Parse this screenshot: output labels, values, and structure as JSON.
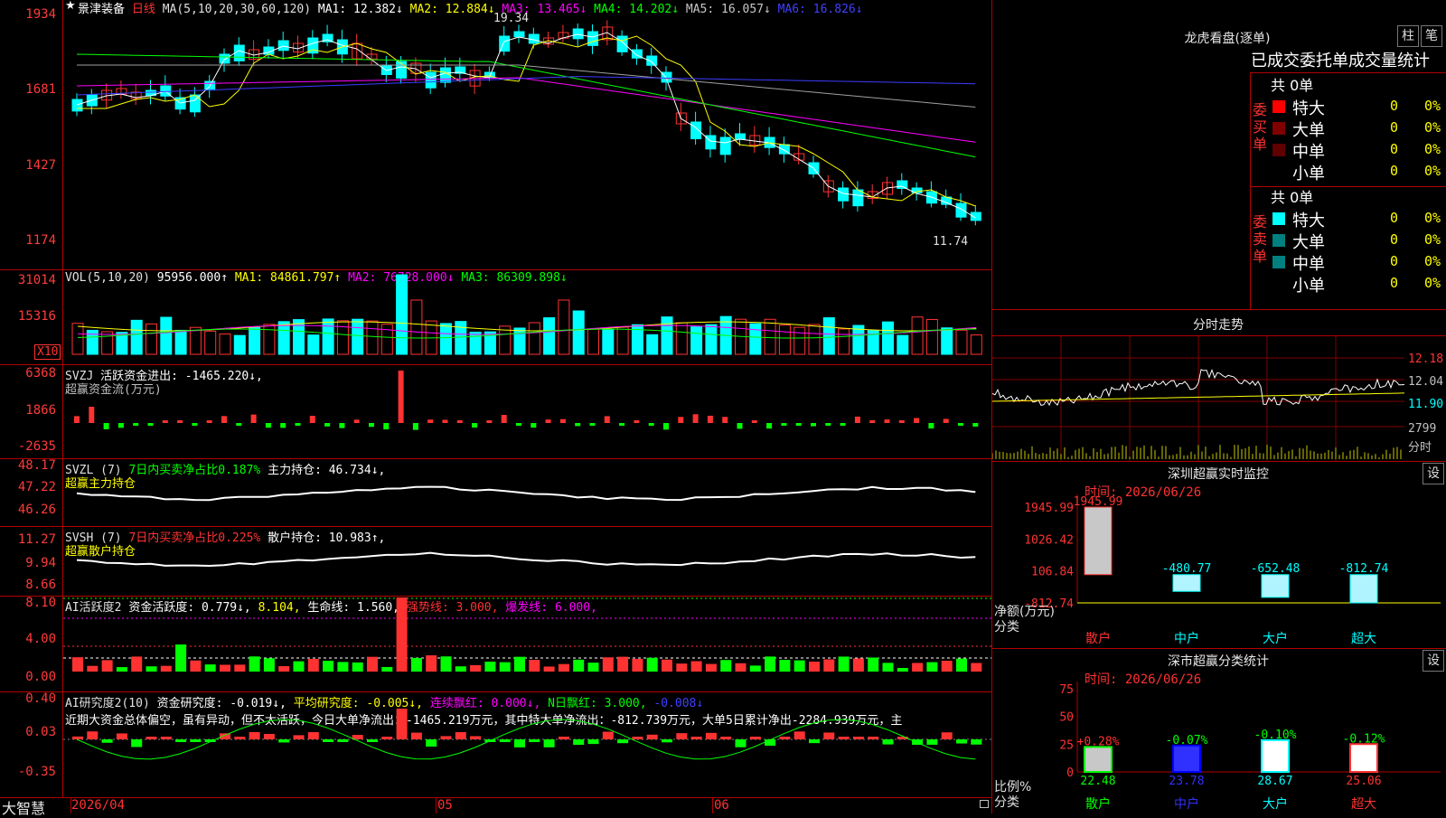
{
  "app": {
    "name": "大智慧"
  },
  "stock": {
    "name": "景津装备",
    "period": "日线"
  },
  "colors": {
    "up": "#ff3232",
    "down": "#00ffff",
    "ma1": "#ffffff",
    "ma2": "#ffff00",
    "ma3": "#ff00ff",
    "ma4": "#00ff00",
    "ma5": "#a0a0a0",
    "ma6": "#3c3cff",
    "vol_ma1": "#ffff00",
    "vol_ma2": "#ff00ff",
    "vol_ma3": "#00ff00",
    "hot": "#ff00ff",
    "green": "#00ff00"
  },
  "price_panel": {
    "header": {
      "ma_params": "MA(5,10,20,30,60,120)",
      "ma1": "MA1: 12.382↓",
      "ma2": "MA2: 12.884↓",
      "ma3": "MA3: 13.465↓",
      "ma4": "MA4: 14.202↓",
      "ma5": "MA5: 16.057↓",
      "ma6": "MA6: 16.826↓"
    },
    "y_ticks": [
      "1934",
      "1681",
      "1427",
      "1174"
    ],
    "high_label": "19.34",
    "low_label": "11.74"
  },
  "volume_panel": {
    "header": {
      "label": "VOL(5,10,20)",
      "value": "95956.000↑",
      "ma1": "MA1: 84861.797↑",
      "ma2": "MA2: 76728.000↓",
      "ma3": "MA3: 86309.898↓"
    },
    "y_ticks": [
      "31014",
      "15316"
    ],
    "unit": "X10"
  },
  "svzj_panel": {
    "header": {
      "label": "SVZJ",
      "text": "活跃资金进出: -1465.220↓,",
      "sub": "超赢资金流(万元)"
    },
    "y_ticks": [
      "6368",
      "1866",
      "-2635"
    ]
  },
  "svzl_panel": {
    "header": {
      "label": "SVZL (7)",
      "text1": "7日内买卖净占比0.187%",
      "text2": "主力持仓: 46.734↓,",
      "sub": "超赢主力持仓"
    },
    "y_ticks": [
      "48.17",
      "47.22",
      "46.26"
    ]
  },
  "svsh_panel": {
    "header": {
      "label": "SVSH (7)",
      "text1": "7日内买卖净占比0.225%",
      "text2": "散户持仓: 10.983↑,",
      "sub": "超赢散户持仓"
    },
    "y_ticks": [
      "11.27",
      "9.94",
      "8.66"
    ]
  },
  "ai_active_panel": {
    "header": {
      "label": "AI活跃度2",
      "t1": "资金活跃度: 0.779↓,",
      "t2": "8.104,",
      "t3": "生命线: 1.560,",
      "t4": "强势线: 3.000,",
      "t5": "爆发线: 6.000,"
    },
    "y_ticks": [
      "8.10",
      "4.00",
      "0.00"
    ]
  },
  "ai_research_panel": {
    "header": {
      "label": "AI研究度2(10)",
      "t1": "资金研究度: -0.019↓,",
      "t2": "平均研究度: -0.005↓,",
      "t3": "连续飘红: 0.000↓,",
      "t4": "N日飘红: 3.000,",
      "t5": "-0.008↓"
    },
    "text": "近期大资金总体偏空，虽有异动，但不太活跃，今日大单净流出：-1465.219万元，其中特大单净流出：-812.739万元，大单5日累计净出-2284.939万元，主",
    "y_ticks": [
      "0.40",
      "0.03",
      "-0.35"
    ]
  },
  "x_axis": {
    "labels": [
      "2026/04",
      "05",
      "06"
    ]
  },
  "right": {
    "dragon": {
      "title": "龙虎看盘(逐单)",
      "tab1": "柱",
      "tab2": "笔",
      "subtitle": "已成交委托单成交量统计",
      "buy": {
        "side": "委买单",
        "total": "共 0单",
        "rows": [
          {
            "label": "特大",
            "count": "0",
            "pct": "0%",
            "color": "#ff0000"
          },
          {
            "label": "大单",
            "count": "0",
            "pct": "0%",
            "color": "#800000"
          },
          {
            "label": "中单",
            "count": "0",
            "pct": "0%",
            "color": "#600000"
          },
          {
            "label": "小单",
            "count": "0",
            "pct": "0%",
            "color": "#000000"
          }
        ]
      },
      "sell": {
        "side": "委卖单",
        "total": "共 0单",
        "rows": [
          {
            "label": "特大",
            "count": "0",
            "pct": "0%",
            "color": "#00ffff"
          },
          {
            "label": "大单",
            "count": "0",
            "pct": "0%",
            "color": "#008080"
          },
          {
            "label": "中单",
            "count": "0",
            "pct": "0%",
            "color": "#008080"
          },
          {
            "label": "小单",
            "count": "0",
            "pct": "0%",
            "color": "#000000"
          }
        ]
      }
    },
    "intraday": {
      "title": "分时走势",
      "y_labels": [
        "12.18",
        "12.04",
        "11.90"
      ],
      "vol_label": "2799",
      "unit": "分时"
    },
    "monitor": {
      "title": "深圳超赢实时监控",
      "settings": "设",
      "time": "时间: 2026/06/26",
      "y_ticks": [
        "1945.99",
        "1026.42",
        "106.84",
        "-812.74"
      ],
      "axis_label": "净额(万元)",
      "cat_label": "分类",
      "bars": [
        {
          "cat": "散户",
          "value": 1945.99,
          "label": "1945.99"
        },
        {
          "cat": "中户",
          "value": -480.77,
          "label": "-480.77"
        },
        {
          "cat": "大户",
          "value": -652.48,
          "label": "-652.48"
        },
        {
          "cat": "超大",
          "value": -812.74,
          "label": "-812.74"
        }
      ]
    },
    "classify": {
      "title": "深市超赢分类统计",
      "settings": "设",
      "time": "时间: 2026/06/26",
      "y_ticks": [
        "75",
        "50",
        "25",
        "0"
      ],
      "axis_label": "比例%",
      "cat_label": "分类",
      "bars": [
        {
          "cat": "散户",
          "value": 22.48,
          "change": "+0.28%"
        },
        {
          "cat": "中户",
          "value": 23.78,
          "change": "-0.07%"
        },
        {
          "cat": "大户",
          "value": 28.67,
          "change": "-0.10%"
        },
        {
          "cat": "超大",
          "value": 25.06,
          "change": "-0.12%"
        }
      ]
    }
  }
}
